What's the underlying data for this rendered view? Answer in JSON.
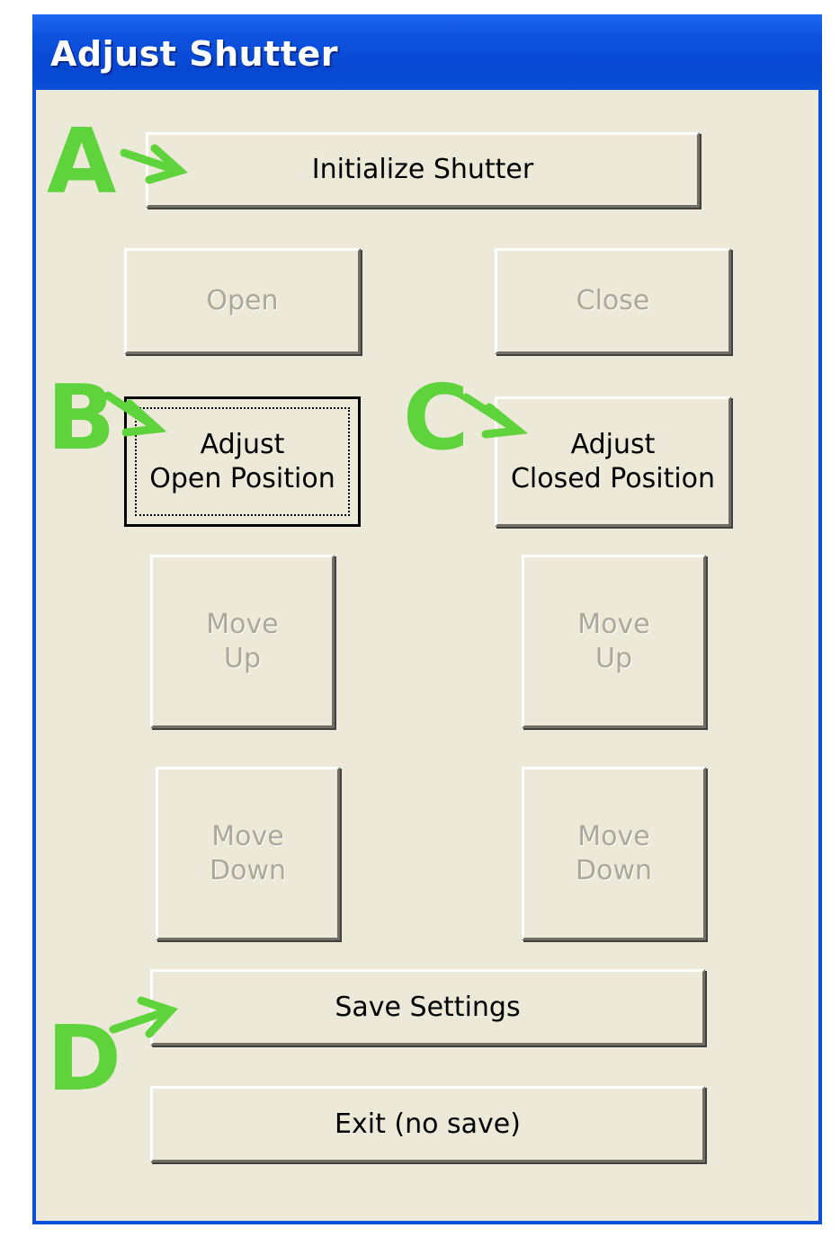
{
  "window": {
    "title": "Adjust Shutter"
  },
  "buttons": {
    "initialize": "Initialize Shutter",
    "open": "Open",
    "close": "Close",
    "adjust_open": "Adjust\nOpen Position",
    "adjust_closed": "Adjust\nClosed Position",
    "move_up_left": "Move\nUp",
    "move_up_right": "Move\nUp",
    "move_down_left": "Move\nDown",
    "move_down_right": "Move\nDown",
    "save": "Save Settings",
    "exit": "Exit  (no save)"
  },
  "annotations": {
    "a": "A",
    "b": "B",
    "c": "C",
    "d": "D",
    "color": "#5fd33c",
    "arrow_icon": "arrow-icon"
  },
  "colors": {
    "title_bar": "#0a4fd8",
    "dialog_face": "#ece9d8",
    "disabled_text": "#aca899"
  }
}
